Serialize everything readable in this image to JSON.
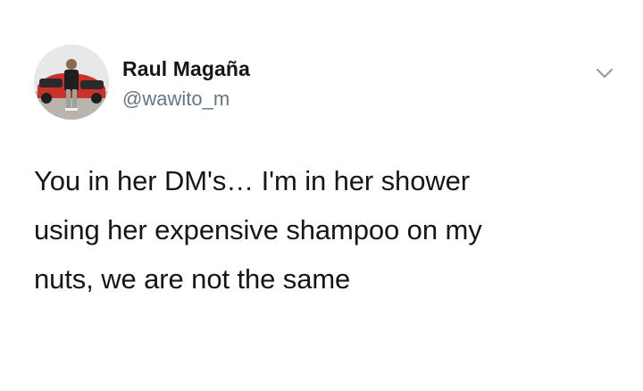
{
  "tweet": {
    "author": {
      "display_name": "Raul Magaña",
      "handle": "@wawito_m",
      "avatar_icon": "profile-photo"
    },
    "menu_icon": "chevron-down-icon",
    "text": "You in her DM's… I'm in her shower\nusing her expensive shampoo on my\nnuts, we are not the same"
  }
}
